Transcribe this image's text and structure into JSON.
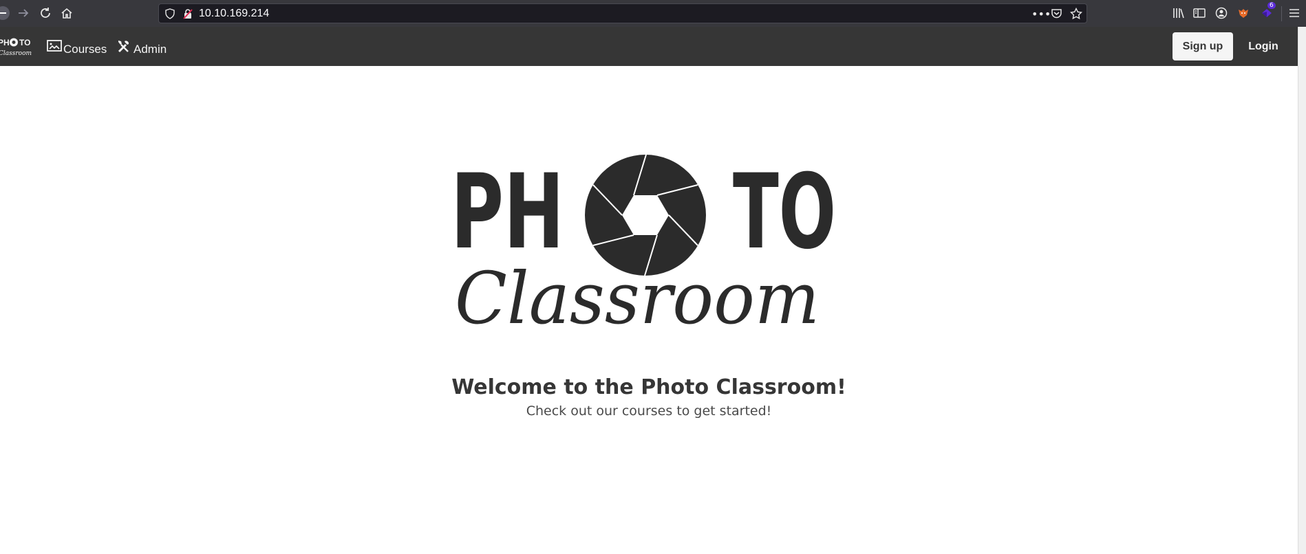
{
  "browser": {
    "url": "10.10.169.214",
    "extension_badge": "6"
  },
  "navbar": {
    "brand": {
      "top": "PH",
      "top2": "TO",
      "bottom": "Classroom"
    },
    "links": [
      {
        "label": "Courses",
        "icon": "image-icon"
      },
      {
        "label": "Admin",
        "icon": "tools-icon"
      }
    ],
    "signup_label": "Sign up",
    "login_label": "Login"
  },
  "hero": {
    "logo_top_left": "PH",
    "logo_top_right": "TO",
    "logo_script": "Classroom",
    "title": "Welcome to the Photo Classroom!",
    "subtitle": "Check out our courses to get started!"
  },
  "colors": {
    "navbar_bg": "#363636",
    "text_dark": "#363636",
    "logo": "#2b2b2b"
  }
}
